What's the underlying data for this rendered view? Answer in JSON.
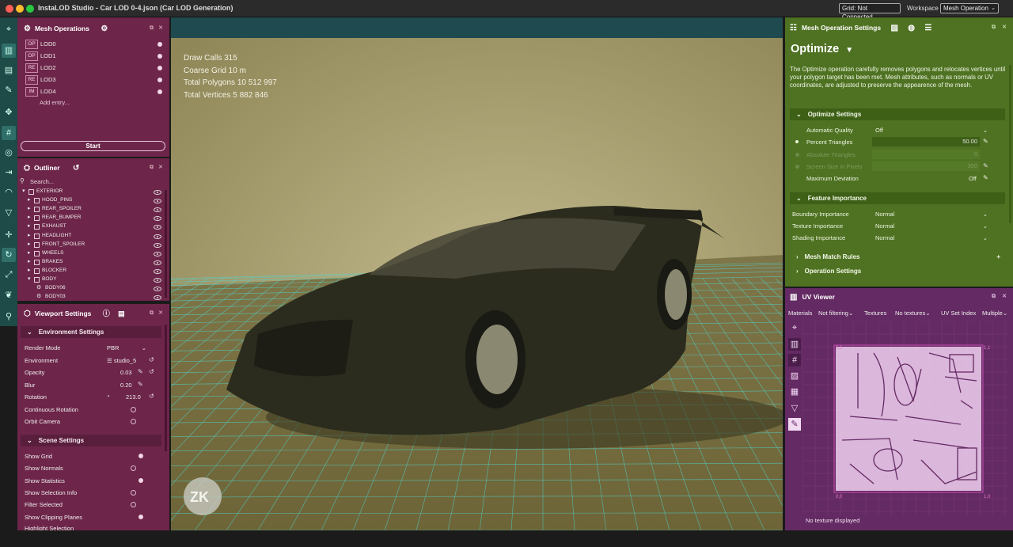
{
  "window": {
    "title": "InstaLOD Studio - Car LOD 0-4.json (Car LOD Generation)"
  },
  "titlebar": {
    "grid_status": "Grid: Not Connected",
    "workspace_label": "Workspace",
    "workspace_value": "Mesh Operation"
  },
  "mesh_operations": {
    "title": "Mesh Operations",
    "items": [
      {
        "tag": "OP",
        "label": "LOD0"
      },
      {
        "tag": "OP",
        "label": "LOD1"
      },
      {
        "tag": "RE",
        "label": "LOD2"
      },
      {
        "tag": "RE",
        "label": "LOD3"
      },
      {
        "tag": "IM",
        "label": "LOD4"
      }
    ],
    "add_entry": "Add entry...",
    "start_button": "Start"
  },
  "outliner": {
    "title": "Outliner",
    "search_placeholder": "Search...",
    "items": [
      {
        "label": "EXTERIOR",
        "level": 0
      },
      {
        "label": "HOOD_PINS",
        "level": 1
      },
      {
        "label": "REAR_SPOILER",
        "level": 1
      },
      {
        "label": "REAR_BUMPER",
        "level": 1
      },
      {
        "label": "EXHAUST",
        "level": 1
      },
      {
        "label": "HEADLIGHT",
        "level": 1
      },
      {
        "label": "FRONT_SPOILER",
        "level": 1
      },
      {
        "label": "WHEELS",
        "level": 1
      },
      {
        "label": "BRAKES",
        "level": 1
      },
      {
        "label": "BLOCKER",
        "level": 1
      },
      {
        "label": "BODY",
        "level": 1
      },
      {
        "label": "BODY06",
        "level": 2
      },
      {
        "label": "BODY03",
        "level": 2
      }
    ]
  },
  "viewport_settings": {
    "title": "Viewport Settings",
    "environment_section": "Environment Settings",
    "render_mode_label": "Render Mode",
    "render_mode_value": "PBR",
    "environment_label": "Environment",
    "environment_value": "studio_5",
    "opacity_label": "Opacity",
    "opacity_value": "0.03",
    "blur_label": "Blur",
    "blur_value": "0.20",
    "rotation_label": "Rotation",
    "rotation_value": "213.0",
    "continuous_rotation_label": "Continuous Rotation",
    "orbit_camera_label": "Orbit Camera",
    "scene_section": "Scene Settings",
    "show_grid": "Show Grid",
    "show_normals": "Show Normals",
    "show_statistics": "Show Statistics",
    "show_selection_info": "Show Selection Info",
    "filter_selected": "Filter Selected",
    "show_clipping_planes": "Show Clipping Planes",
    "highlight_selection": "Highlight Selection"
  },
  "viewport": {
    "stats": [
      "Draw Calls 315",
      "Coarse Grid 10 m",
      "Total Polygons 10 512 997",
      "Total Vertices 5 882 846"
    ],
    "logo_text": "ZK"
  },
  "mesh_op_settings": {
    "title": "Mesh Operation Settings",
    "operation": "Optimize",
    "description": "The Optimize operation carefully removes polygons and relocates vertices until your polygon target has been met. Mesh attributes, such as normals or UV coordinates, are adjusted to preserve the appearence of the mesh.",
    "optimize_section": "Optimize Settings",
    "automatic_quality_label": "Automatic Quality",
    "automatic_quality_value": "Off",
    "percent_triangles_label": "Percent Triangles",
    "percent_triangles_value": "50.00",
    "absolute_triangles_label": "Absolute Triangles",
    "absolute_triangles_value": "0",
    "screen_size_label": "Screen Size in Pixels",
    "screen_size_value": "300",
    "max_deviation_label": "Maximum Deviation",
    "max_deviation_value": "Off",
    "feature_section": "Feature Importance",
    "boundary_label": "Boundary Importance",
    "boundary_value": "Normal",
    "texture_label": "Texture Importance",
    "texture_value": "Normal",
    "shading_label": "Shading Importance",
    "shading_value": "Normal",
    "mesh_match_section": "Mesh Match Rules",
    "operation_section": "Operation Settings"
  },
  "uv_viewer": {
    "title": "UV Viewer",
    "materials_label": "Materials",
    "materials_value": "Not filtering",
    "textures_label": "Textures",
    "textures_value": "No textures",
    "uvset_label": "UV Set Index",
    "uvset_value": "Multiple",
    "corner_tl": "0,1",
    "corner_tr": "1,1",
    "corner_bl": "0,0",
    "corner_br": "1,0",
    "footer": "No texture displayed"
  },
  "colors": {
    "mesh_panel": "#6d2549",
    "settings_panel": "#4e7222",
    "uv_panel": "#642a63",
    "toolbar": "#1e4a47",
    "viewport_bg": "#aaa070",
    "grid": "#4fd6d2"
  }
}
